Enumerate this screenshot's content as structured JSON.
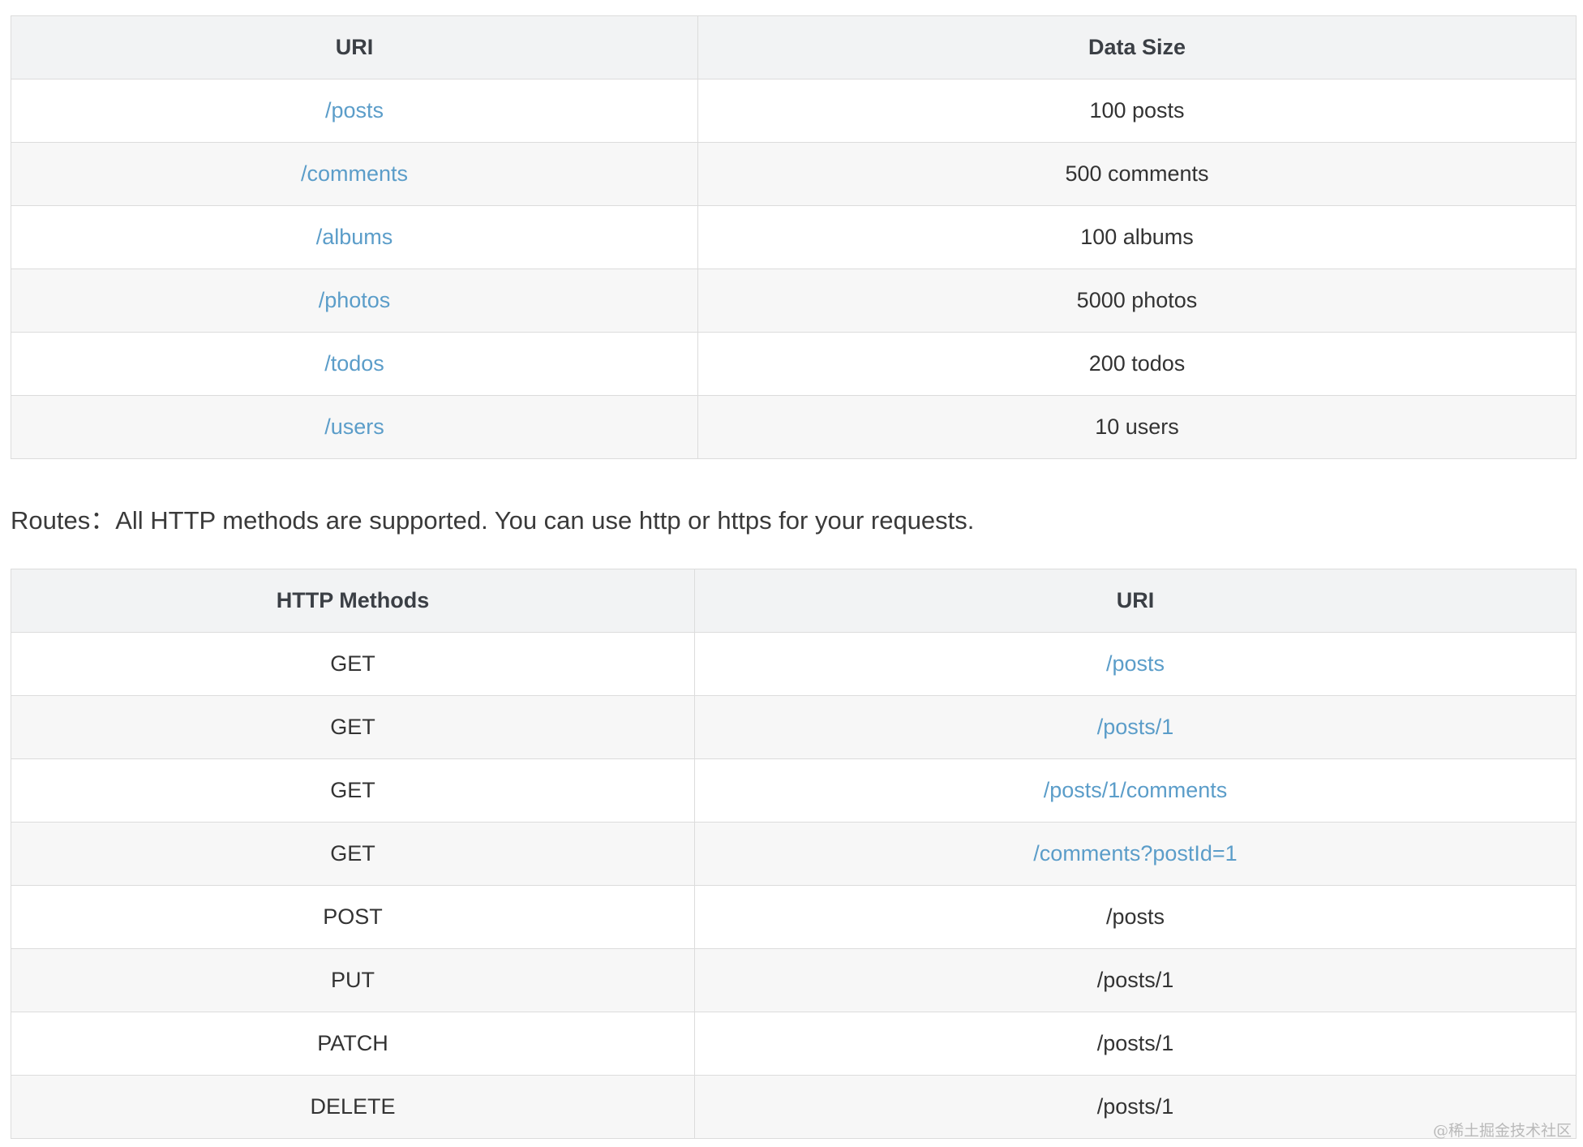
{
  "resources_table": {
    "headers": [
      "URI",
      "Data Size"
    ],
    "rows": [
      {
        "uri": "/posts",
        "size": "100 posts"
      },
      {
        "uri": "/comments",
        "size": "500 comments"
      },
      {
        "uri": "/albums",
        "size": "100 albums"
      },
      {
        "uri": "/photos",
        "size": "5000 photos"
      },
      {
        "uri": "/todos",
        "size": "200 todos"
      },
      {
        "uri": "/users",
        "size": "10 users"
      }
    ]
  },
  "routes_text": "Routes：All HTTP methods are supported. You can use http or https for your requests.",
  "routes_table": {
    "headers": [
      "HTTP Methods",
      "URI"
    ],
    "rows": [
      {
        "method": "GET",
        "uri": "/posts"
      },
      {
        "method": "GET",
        "uri": "/posts/1"
      },
      {
        "method": "GET",
        "uri": "/posts/1/comments"
      },
      {
        "method": "GET",
        "uri": "/comments?postId=1"
      },
      {
        "method": "POST",
        "uri": "/posts"
      },
      {
        "method": "PUT",
        "uri": "/posts/1"
      },
      {
        "method": "PATCH",
        "uri": "/posts/1"
      },
      {
        "method": "DELETE",
        "uri": "/posts/1"
      }
    ]
  },
  "watermark": "@稀土掘金技术社区",
  "colors": {
    "link": "#5b9dc9",
    "text": "#333333",
    "header_bg": "#f2f3f4",
    "stripe_bg": "#f7f7f7",
    "border": "#dcdcdc"
  }
}
